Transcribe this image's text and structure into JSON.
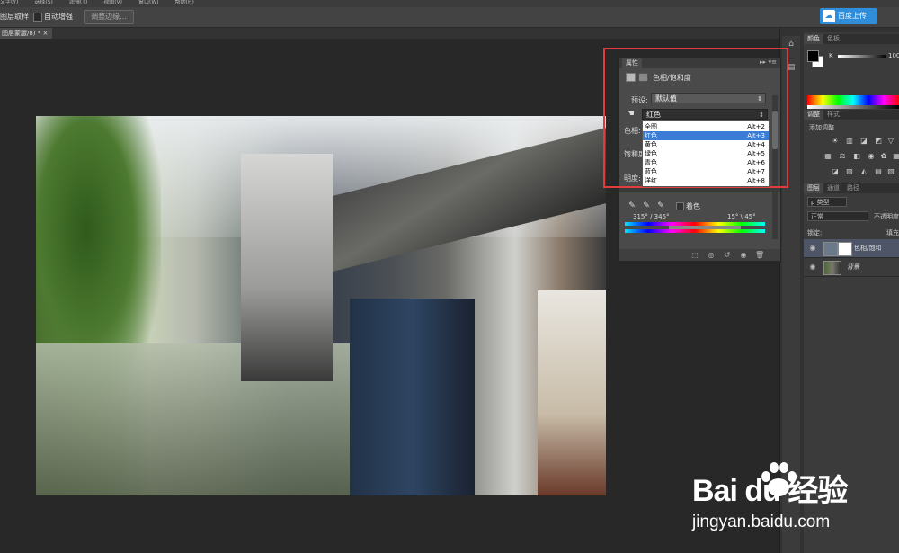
{
  "menubar": {
    "items": [
      "文字(Y)",
      "选择(S)",
      "滤镜(T)",
      "视图(V)",
      "窗口(W)",
      "帮助(H)"
    ]
  },
  "options_bar": {
    "sample_layers": "图层取样",
    "auto_enhance": "自动增强",
    "refine_edge": "调整边缘...",
    "upload_button": "百度上传"
  },
  "document": {
    "tab_title": "图层蒙版/8) *",
    "tab_close": "×"
  },
  "properties": {
    "panel_title": "属性",
    "collapse": "▸▸",
    "menu": "▾≡",
    "adjust_title": "色相/饱和度",
    "preset_label": "预设:",
    "preset_value": "默认值",
    "channel_value": "红色",
    "hue_label": "色相:",
    "sat_label": "饱和度",
    "light_label": "明度:",
    "dropdown": [
      {
        "label": "全图",
        "key": "Alt+2"
      },
      {
        "label": "红色",
        "key": "Alt+3"
      },
      {
        "label": "黄色",
        "key": "Alt+4"
      },
      {
        "label": "绿色",
        "key": "Alt+5"
      },
      {
        "label": "青色",
        "key": "Alt+6"
      },
      {
        "label": "蓝色",
        "key": "Alt+7"
      },
      {
        "label": "洋红",
        "key": "Alt+8"
      }
    ],
    "colorize_label": "着色",
    "range_left": "315° / 345°",
    "range_right": "15° \\ 45°"
  },
  "color_panel": {
    "tab_color": "颜色",
    "tab_swatches": "色板",
    "k_label": "K",
    "k_value": "100"
  },
  "adjust_panel": {
    "tab_adjust": "调整",
    "tab_styles": "样式",
    "title": "添加调整"
  },
  "layers_panel": {
    "tab_layers": "图层",
    "tab_channels": "通道",
    "tab_paths": "路径",
    "filter": "ρ 类型",
    "blend_mode": "正常",
    "opacity_label": "不透明度",
    "lock_label": "锁定:",
    "fill_label": "填充",
    "layers": [
      {
        "name": "色相/饱和"
      },
      {
        "name": "背景"
      }
    ]
  },
  "watermark": {
    "logo": "Bai du 经验",
    "url": "jingyan.baidu.com"
  },
  "colors": {
    "highlight": "#e23b3b",
    "selection": "#3a7cd6",
    "upload": "#2f8edc"
  }
}
